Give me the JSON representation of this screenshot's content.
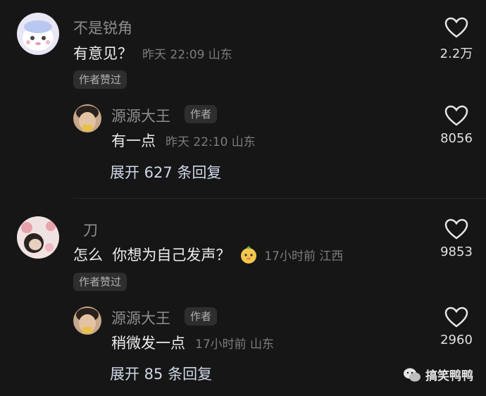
{
  "threads": [
    {
      "comment": {
        "username": "不是锐角",
        "text": "有意见？",
        "meta": "昨天 22:09 山东",
        "badge": "作者赞过",
        "likes": "2.2万"
      },
      "reply": {
        "username": "源源大王",
        "author_tag": "作者",
        "text": "有一点",
        "meta": "昨天 22:10 山东",
        "likes": "8056"
      },
      "expand": "展开 627 条回复"
    },
    {
      "comment": {
        "username": "刀",
        "text": "怎么  你想为自己发声？",
        "meta": "17小时前 江西",
        "badge": "作者赞过",
        "likes": "9853"
      },
      "reply": {
        "username": "源源大王",
        "author_tag": "作者",
        "text": "稍微发一点",
        "meta": "17小时前 山东",
        "likes": "2960"
      },
      "expand": "展开 85 条回复"
    }
  ],
  "watermark": "搞笑鸭鸭",
  "colors": {
    "background": "#161616",
    "muted": "#8d8d8d",
    "badge_bg": "#2e2e2e"
  },
  "icons": [
    "heart-outline-icon",
    "wechat-icon",
    "duck-emoji-icon"
  ]
}
